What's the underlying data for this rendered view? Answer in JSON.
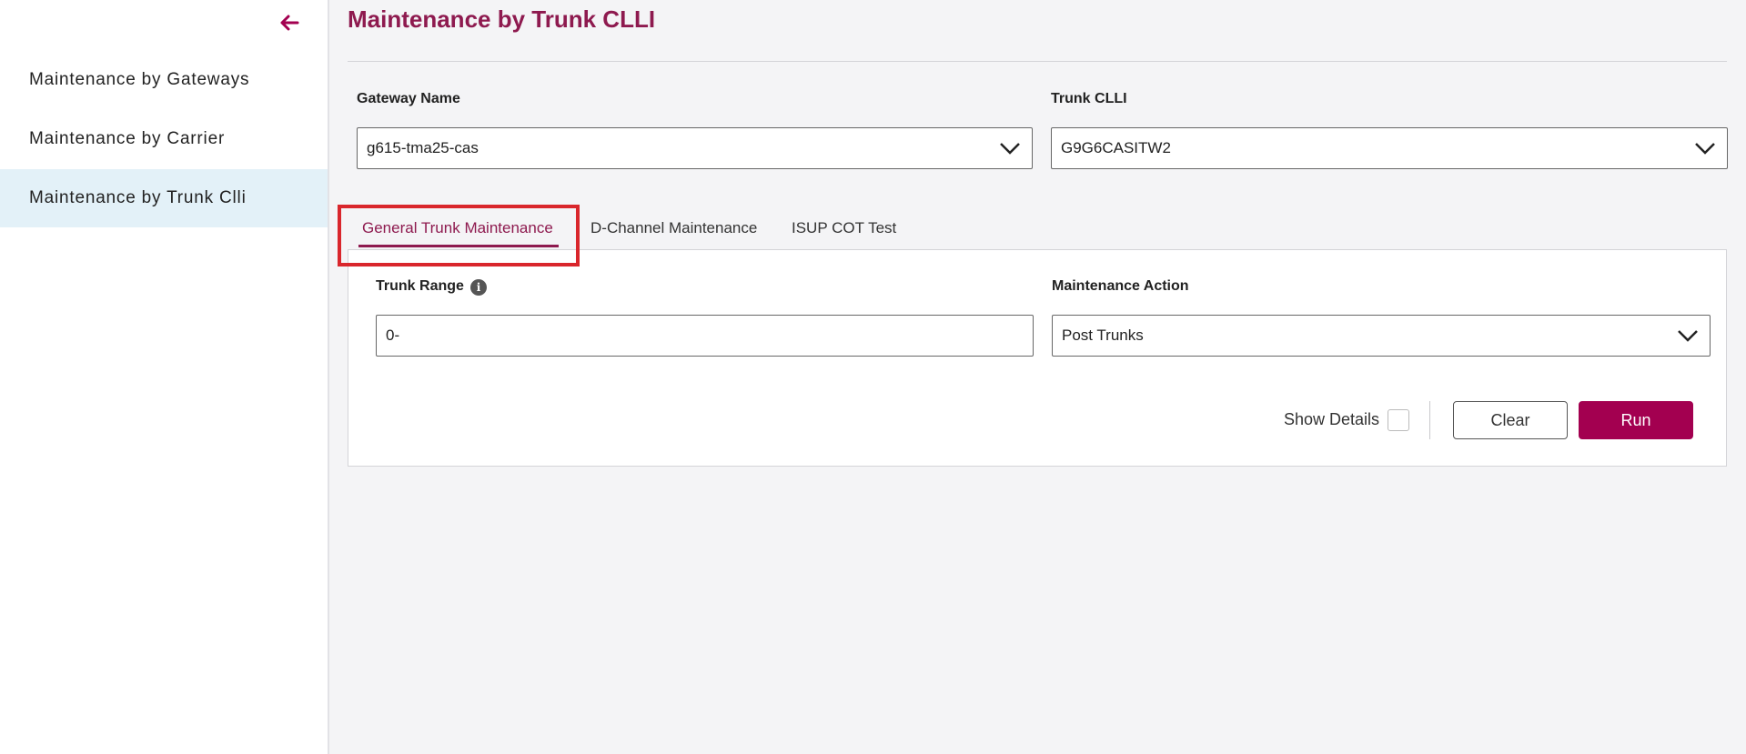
{
  "sidebar": {
    "back_icon": "arrow-left-icon",
    "items": [
      {
        "label": "Maintenance by Gateways"
      },
      {
        "label": "Maintenance by Carrier"
      },
      {
        "label": "Maintenance by Trunk Clli"
      }
    ]
  },
  "main": {
    "title": "Maintenance by Trunk CLLI",
    "gateway": {
      "label": "Gateway Name",
      "value": "g615-tma25-cas"
    },
    "trunk_clli": {
      "label": "Trunk CLLI",
      "value": "G9G6CASITW2"
    },
    "tabs": [
      {
        "label": "General Trunk Maintenance",
        "active": true
      },
      {
        "label": "D-Channel Maintenance",
        "active": false
      },
      {
        "label": "ISUP COT Test",
        "active": false
      }
    ],
    "panel": {
      "trunk_range": {
        "label": "Trunk Range",
        "value": "0-",
        "info_icon": "info-icon"
      },
      "maintenance_action": {
        "label": "Maintenance Action",
        "value": "Post Trunks"
      },
      "show_details_label": "Show Details",
      "clear_label": "Clear",
      "run_label": "Run"
    }
  },
  "colors": {
    "accent": "#8e1a4f",
    "run_button": "#a30050",
    "active_nav_bg": "#e3f1f8",
    "highlight": "#d9262c"
  }
}
